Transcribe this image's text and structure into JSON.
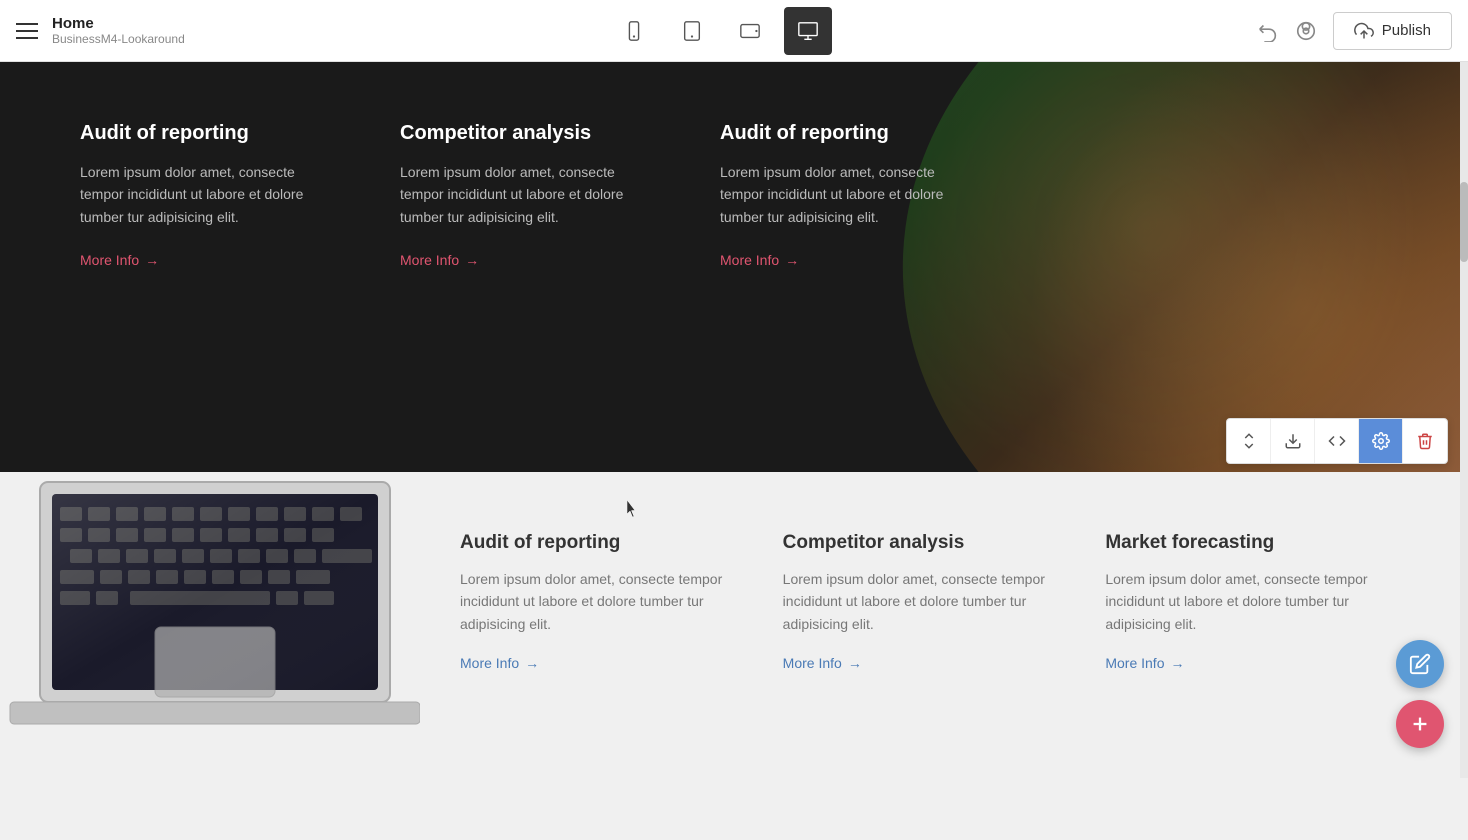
{
  "nav": {
    "hamburger_label": "Menu",
    "title": "Home",
    "subtitle": "BusinessM4-Lookaround",
    "devices": [
      {
        "name": "mobile",
        "label": "Mobile view"
      },
      {
        "name": "tablet",
        "label": "Tablet view"
      },
      {
        "name": "tablet-landscape",
        "label": "Tablet landscape view"
      },
      {
        "name": "desktop",
        "label": "Desktop view"
      }
    ],
    "undo_label": "Undo",
    "preview_label": "Preview",
    "publish_label": "Publish",
    "publish_icon": "cloud-upload"
  },
  "dark_section": {
    "cards": [
      {
        "title": "Audit of reporting",
        "body": "Lorem ipsum dolor amet, consecte tempor incididunt ut labore et dolore tumber tur adipisicing elit.",
        "link": "More Info"
      },
      {
        "title": "Competitor analysis",
        "body": "Lorem ipsum dolor amet, consecte tempor incididunt ut labore et dolore tumber tur adipisicing elit.",
        "link": "More Info"
      },
      {
        "title": "Audit of reporting",
        "body": "Lorem ipsum dolor amet, consecte tempor incididunt ut labore et dolore tumber tur adipisicing elit.",
        "link": "More Info"
      }
    ]
  },
  "light_section": {
    "cards": [
      {
        "title": "Audit of reporting",
        "body": "Lorem ipsum dolor amet, consecte tempor incididunt ut labore et dolore tumber tur adipisicing elit.",
        "link": "More Info"
      },
      {
        "title": "Competitor analysis",
        "body": "Lorem ipsum dolor amet, consecte tempor incididunt ut labore et dolore tumber tur adipisicing elit.",
        "link": "More Info"
      },
      {
        "title": "Market forecasting",
        "body": "Lorem ipsum dolor amet, consecte tempor incididunt ut labore et dolore tumber tur adipisicing elit.",
        "link": "More Info"
      }
    ]
  },
  "toolbar": {
    "move_up_down": "Move up/down",
    "download": "Download",
    "code": "Code",
    "settings": "Settings",
    "delete": "Delete"
  }
}
